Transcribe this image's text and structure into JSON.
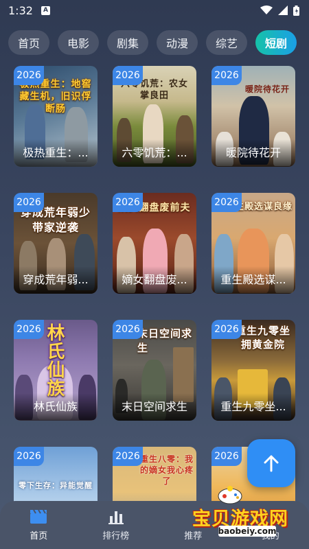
{
  "status_bar": {
    "time": "1:32",
    "notification_badge": "A",
    "icons": [
      "wifi-icon",
      "signal-icon",
      "battery-icon"
    ]
  },
  "category_tabs": [
    {
      "label": "首页",
      "active": false
    },
    {
      "label": "电影",
      "active": false
    },
    {
      "label": "剧集",
      "active": false
    },
    {
      "label": "动漫",
      "active": false
    },
    {
      "label": "综艺",
      "active": false
    },
    {
      "label": "短剧",
      "active": true
    }
  ],
  "dramas": [
    {
      "year": "2026",
      "title": "极热重生：...",
      "poster_text": "极热重生：地窖藏生机，旧识俘断肠"
    },
    {
      "year": "2026",
      "title": "六零饥荒：...",
      "poster_text": "六零饥荒：农女掌良田"
    },
    {
      "year": "2026",
      "title": "暖院待花开",
      "poster_text": "暖院待花开"
    },
    {
      "year": "2026",
      "title": "穿成荒年弱...",
      "poster_text": "穿成荒年弱少带家逆袭"
    },
    {
      "year": "2026",
      "title": "嫡女翻盘废...",
      "poster_text": "嫡女翻盘废前夫"
    },
    {
      "year": "2026",
      "title": "重生殿选谋...",
      "poster_text": "重生殿选谋良缘"
    },
    {
      "year": "2026",
      "title": "林氏仙族",
      "poster_text": "林氏仙族"
    },
    {
      "year": "2026",
      "title": "末日空间求生",
      "poster_text": "末日空间求生"
    },
    {
      "year": "2026",
      "title": "重生九零坐...",
      "poster_text": "重生九零坐拥黄金院"
    },
    {
      "year": "2026",
      "title": "",
      "poster_text": "零下生存：异能觉醒"
    },
    {
      "year": "2026",
      "title": "",
      "poster_text": "重生八零：我的嫡女我心疼了"
    },
    {
      "year": "2026",
      "title": "",
      "poster_text": ""
    }
  ],
  "fab": {
    "icon": "arrow-up-icon"
  },
  "bottom_nav": [
    {
      "label": "首页",
      "icon": "clapperboard-icon",
      "active": true
    },
    {
      "label": "排行榜",
      "icon": "bar-chart-icon",
      "active": false
    },
    {
      "label": "推荐",
      "icon": "recommend-icon",
      "active": false
    },
    {
      "label": "我的",
      "icon": "profile-icon",
      "active": false
    }
  ],
  "watermark": {
    "text": "宝贝游戏网",
    "url": "baobeiy.com"
  },
  "colors": {
    "accent_blue": "#2f8ef5",
    "active_tab_start": "#16c2a8",
    "active_tab_end": "#1b9fe6",
    "badge_blue": "#3d86e6"
  }
}
